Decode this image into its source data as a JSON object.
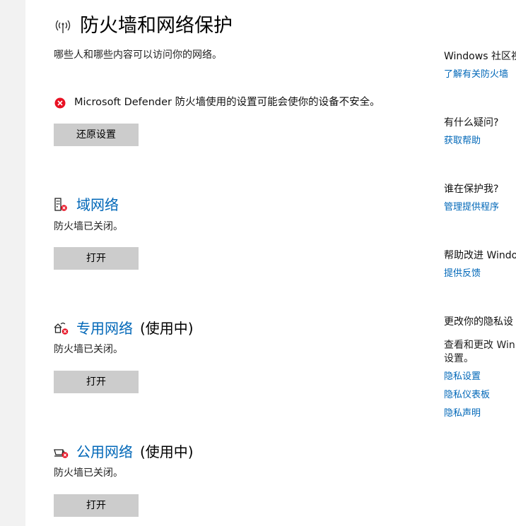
{
  "header": {
    "title": "防火墙和网络保护",
    "subtitle": "哪些人和哪些内容可以访问你的网络。",
    "icon": "wireless-antenna-icon"
  },
  "warning": {
    "icon": "error-circle-icon",
    "text": "Microsoft Defender 防火墙使用的设置可能会使你的设备不安全。",
    "button_label": "还原设置"
  },
  "networks": {
    "domain": {
      "icon": "building-network-icon",
      "title": "域网络",
      "in_use": "",
      "status": "防火墙已关闭。",
      "button_label": "打开"
    },
    "private": {
      "icon": "home-network-icon",
      "title": "专用网络",
      "in_use": "(使用中)",
      "status": "防火墙已关闭。",
      "button_label": "打开"
    },
    "public": {
      "icon": "coffee-network-icon",
      "title": "公用网络",
      "in_use": "(使用中)",
      "status": "防火墙已关闭。",
      "button_label": "打开"
    }
  },
  "sidebar": {
    "community": {
      "heading": "Windows 社区视",
      "link": "了解有关防火墙"
    },
    "question": {
      "heading": "有什么疑问?",
      "link": "获取帮助"
    },
    "who_protects": {
      "heading": "谁在保护我?",
      "link": "管理提供程序"
    },
    "improve": {
      "heading": "帮助改进 Windo",
      "link": "提供反馈"
    },
    "privacy": {
      "heading": "更改你的隐私设",
      "body_line1": "查看和更改 Win",
      "body_line2": "设置。",
      "links": [
        "隐私设置",
        "隐私仪表板",
        "隐私声明"
      ]
    }
  },
  "colors": {
    "link": "#0067b8",
    "error": "#e81123",
    "button_bg": "#cccccc",
    "left_strip": "#f2f2f2"
  }
}
